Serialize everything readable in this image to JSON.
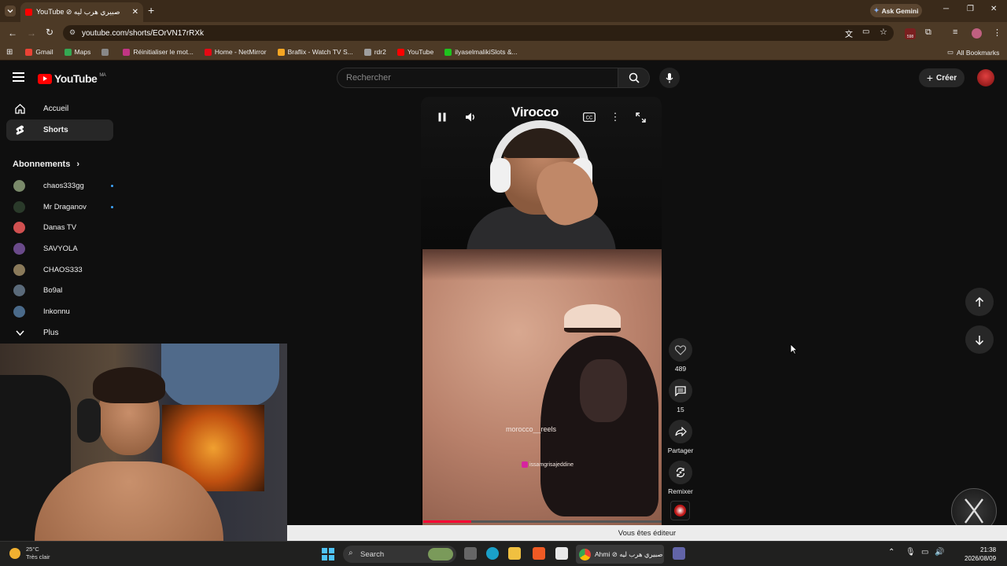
{
  "browser": {
    "tab_title": "YouTube ⊘ صبيري هرب ليه",
    "url": "youtube.com/shorts/EOrVN17rRXk",
    "ask_gemini": "Ask Gemini",
    "ext_badge": "598",
    "bookmarks": [
      {
        "label": "Gmail",
        "color": "#ea4335"
      },
      {
        "label": "Maps",
        "color": "#34a853"
      },
      {
        "label": "",
        "color": "#888888"
      },
      {
        "label": "Réinitialiser le mot...",
        "color": "#c13584"
      },
      {
        "label": "Home - NetMirror",
        "color": "#e50914"
      },
      {
        "label": "Braflix - Watch TV S...",
        "color": "#f5a623"
      },
      {
        "label": "rdr2",
        "color": "#9e9e9e"
      },
      {
        "label": "YouTube",
        "color": "#ff0000"
      },
      {
        "label": "ilyaselmalikiSlots &...",
        "color": "#1ec31e"
      }
    ],
    "all_bookmarks": "All Bookmarks"
  },
  "header": {
    "logo_text": "YouTube",
    "logo_region": "MA",
    "search_placeholder": "Rechercher",
    "create_label": "Créer"
  },
  "sidebar": {
    "main": [
      {
        "label": "Accueil",
        "icon": "home-icon",
        "active": false
      },
      {
        "label": "Shorts",
        "icon": "shorts-icon",
        "active": true
      }
    ],
    "subs_title": "Abonnements",
    "subs": [
      {
        "label": "chaos333gg",
        "color": "#7a8a6a",
        "new": true
      },
      {
        "label": "Mr Draganov",
        "color": "#2a3a2a",
        "new": true
      },
      {
        "label": "Danas TV",
        "color": "#d05050",
        "new": false
      },
      {
        "label": "SAVYOLA",
        "color": "#6a4a8a",
        "new": false
      },
      {
        "label": "CHAOS333",
        "color": "#8a7a5a",
        "new": false
      },
      {
        "label": "Bo9al",
        "color": "#5a6a7a",
        "new": false
      },
      {
        "label": "Inkonnu",
        "color": "#4a6a8a",
        "new": false
      }
    ],
    "more_label": "Plus"
  },
  "short": {
    "channel_overlay": "Virocco",
    "watermark_1": "morocco__reels",
    "watermark_2": "issamgrisajeddine",
    "progress_fraction": 0.2,
    "likes": "489",
    "comments": "15",
    "share_label": "Partager",
    "remix_label": "Remixer"
  },
  "editor_banner": "Vous êtes éditeur",
  "taskbar": {
    "weather_temp": "25°C",
    "weather_desc": "Très clair",
    "search_label": "Search",
    "active_app_title": "Ahmi ⊘ صبيري هرب ليه",
    "time": "21:38",
    "date": "2026/08/09"
  }
}
